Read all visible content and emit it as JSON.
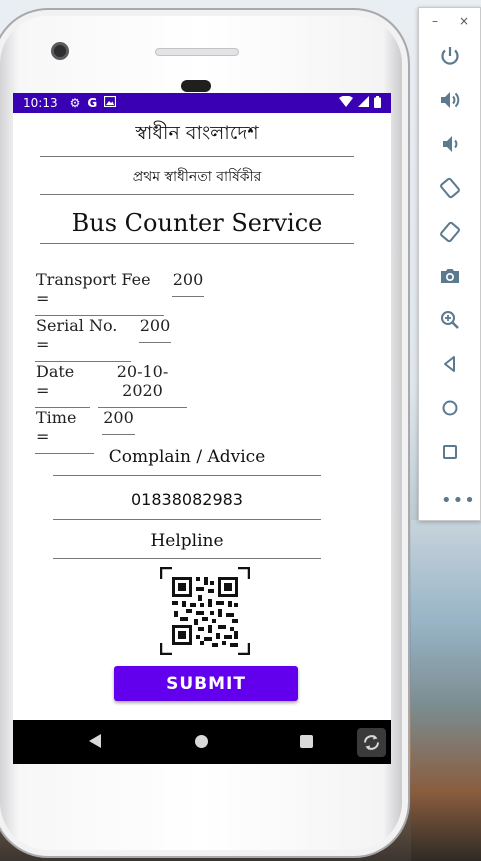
{
  "status_bar": {
    "time": "10:13",
    "icons": [
      "gear-icon",
      "google-icon",
      "photo-icon"
    ],
    "right_icons": [
      "wifi-icon",
      "signal-icon",
      "battery-icon"
    ]
  },
  "app": {
    "title_bn": "স্বাধীন বাংলাদেশ",
    "subtitle_bn": "প্রথম স্বাধীনতা বার্ষিকীর",
    "headline": "Bus Counter Service",
    "fields": [
      {
        "label": "Transport Fee =",
        "value": "200"
      },
      {
        "label": "Serial No. =",
        "value": "200"
      },
      {
        "label": "Date =",
        "value": "20-10-2020"
      },
      {
        "label": "Time =",
        "value": "200"
      }
    ],
    "complain_label": "Complain / Advice",
    "helpline_number": "01838082983",
    "helpline_label": "Helpline",
    "submit_label": "SUBMIT",
    "accent_color": "#6200ee",
    "status_bar_color": "#3a00b4"
  },
  "nav_bar": {
    "buttons": [
      "back-icon",
      "home-icon",
      "recents-icon",
      "rotate-icon"
    ]
  },
  "emulator_toolbar": {
    "minimize": "–",
    "close": "×",
    "buttons": [
      "power-icon",
      "volume-up-icon",
      "volume-down-icon",
      "rotate-left-icon",
      "rotate-right-icon",
      "camera-icon",
      "zoom-icon",
      "back-icon",
      "home-icon",
      "overview-icon",
      "more-icon"
    ],
    "more_label": "•••"
  }
}
